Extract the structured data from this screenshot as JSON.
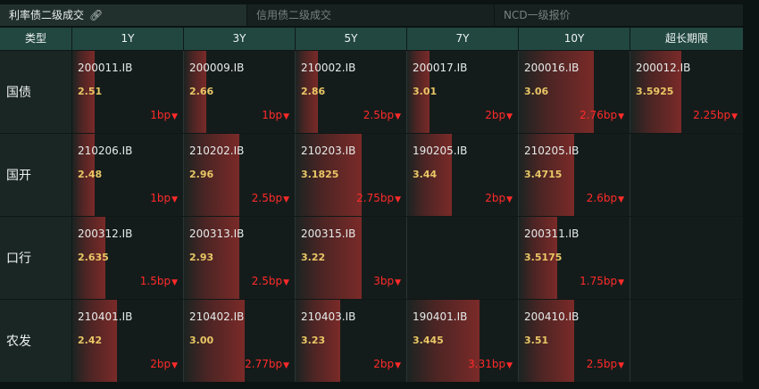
{
  "tabs": [
    {
      "label": "利率债二级成交",
      "active": true,
      "icon": "link-icon"
    },
    {
      "label": "信用债二级成交",
      "active": false
    },
    {
      "label": "NCD一级报价",
      "active": false
    }
  ],
  "columns": [
    "类型",
    "1Y",
    "3Y",
    "5Y",
    "7Y",
    "10Y",
    "超长期限"
  ],
  "colors": {
    "yield": "#e9c766",
    "change_down": "#ff2a2a",
    "bar": "#7a2a28",
    "header": "#214740"
  },
  "rows": [
    {
      "type": "国债",
      "cells": [
        {
          "code": "200011.IB",
          "yield": "2.51",
          "change": "1bp",
          "direction": "down",
          "fill": 0.2
        },
        {
          "code": "200009.IB",
          "yield": "2.66",
          "change": "1bp",
          "direction": "down",
          "fill": 0.2
        },
        {
          "code": "210002.IB",
          "yield": "2.86",
          "change": "2.5bp",
          "direction": "down",
          "fill": 0.2
        },
        {
          "code": "200017.IB",
          "yield": "3.01",
          "change": "2bp",
          "direction": "down",
          "fill": 0.2
        },
        {
          "code": "200016.IB",
          "yield": "3.06",
          "change": "2.76bp",
          "direction": "down",
          "fill": 0.68
        },
        {
          "code": "200012.IB",
          "yield": "3.5925",
          "change": "2.25bp",
          "direction": "down",
          "fill": 0.45
        }
      ]
    },
    {
      "type": "国开",
      "cells": [
        {
          "code": "210206.IB",
          "yield": "2.48",
          "change": "1bp",
          "direction": "down",
          "fill": 0.2
        },
        {
          "code": "210202.IB",
          "yield": "2.96",
          "change": "2.5bp",
          "direction": "down",
          "fill": 0.5
        },
        {
          "code": "210203.IB",
          "yield": "3.1825",
          "change": "2.75bp",
          "direction": "down",
          "fill": 0.6
        },
        {
          "code": "190205.IB",
          "yield": "3.44",
          "change": "2bp",
          "direction": "down",
          "fill": 0.4
        },
        {
          "code": "210205.IB",
          "yield": "3.4715",
          "change": "2.6bp",
          "direction": "down",
          "fill": 0.5
        },
        null
      ]
    },
    {
      "type": "口行",
      "cells": [
        {
          "code": "200312.IB",
          "yield": "2.635",
          "change": "1.5bp",
          "direction": "down",
          "fill": 0.3
        },
        {
          "code": "200313.IB",
          "yield": "2.93",
          "change": "2.5bp",
          "direction": "down",
          "fill": 0.5
        },
        {
          "code": "200315.IB",
          "yield": "3.22",
          "change": "3bp",
          "direction": "down",
          "fill": 0.6
        },
        null,
        {
          "code": "200311.IB",
          "yield": "3.5175",
          "change": "1.75bp",
          "direction": "down",
          "fill": 0.35
        },
        null
      ]
    },
    {
      "type": "农发",
      "cells": [
        {
          "code": "210401.IB",
          "yield": "2.42",
          "change": "2bp",
          "direction": "down",
          "fill": 0.4
        },
        {
          "code": "210402.IB",
          "yield": "3.00",
          "change": "2.77bp",
          "direction": "down",
          "fill": 0.55
        },
        {
          "code": "210403.IB",
          "yield": "3.23",
          "change": "2bp",
          "direction": "down",
          "fill": 0.4
        },
        {
          "code": "190401.IB",
          "yield": "3.445",
          "change": "3.31bp",
          "direction": "down",
          "fill": 0.65
        },
        {
          "code": "200410.IB",
          "yield": "3.51",
          "change": "2.5bp",
          "direction": "down",
          "fill": 0.5
        },
        null
      ]
    }
  ]
}
